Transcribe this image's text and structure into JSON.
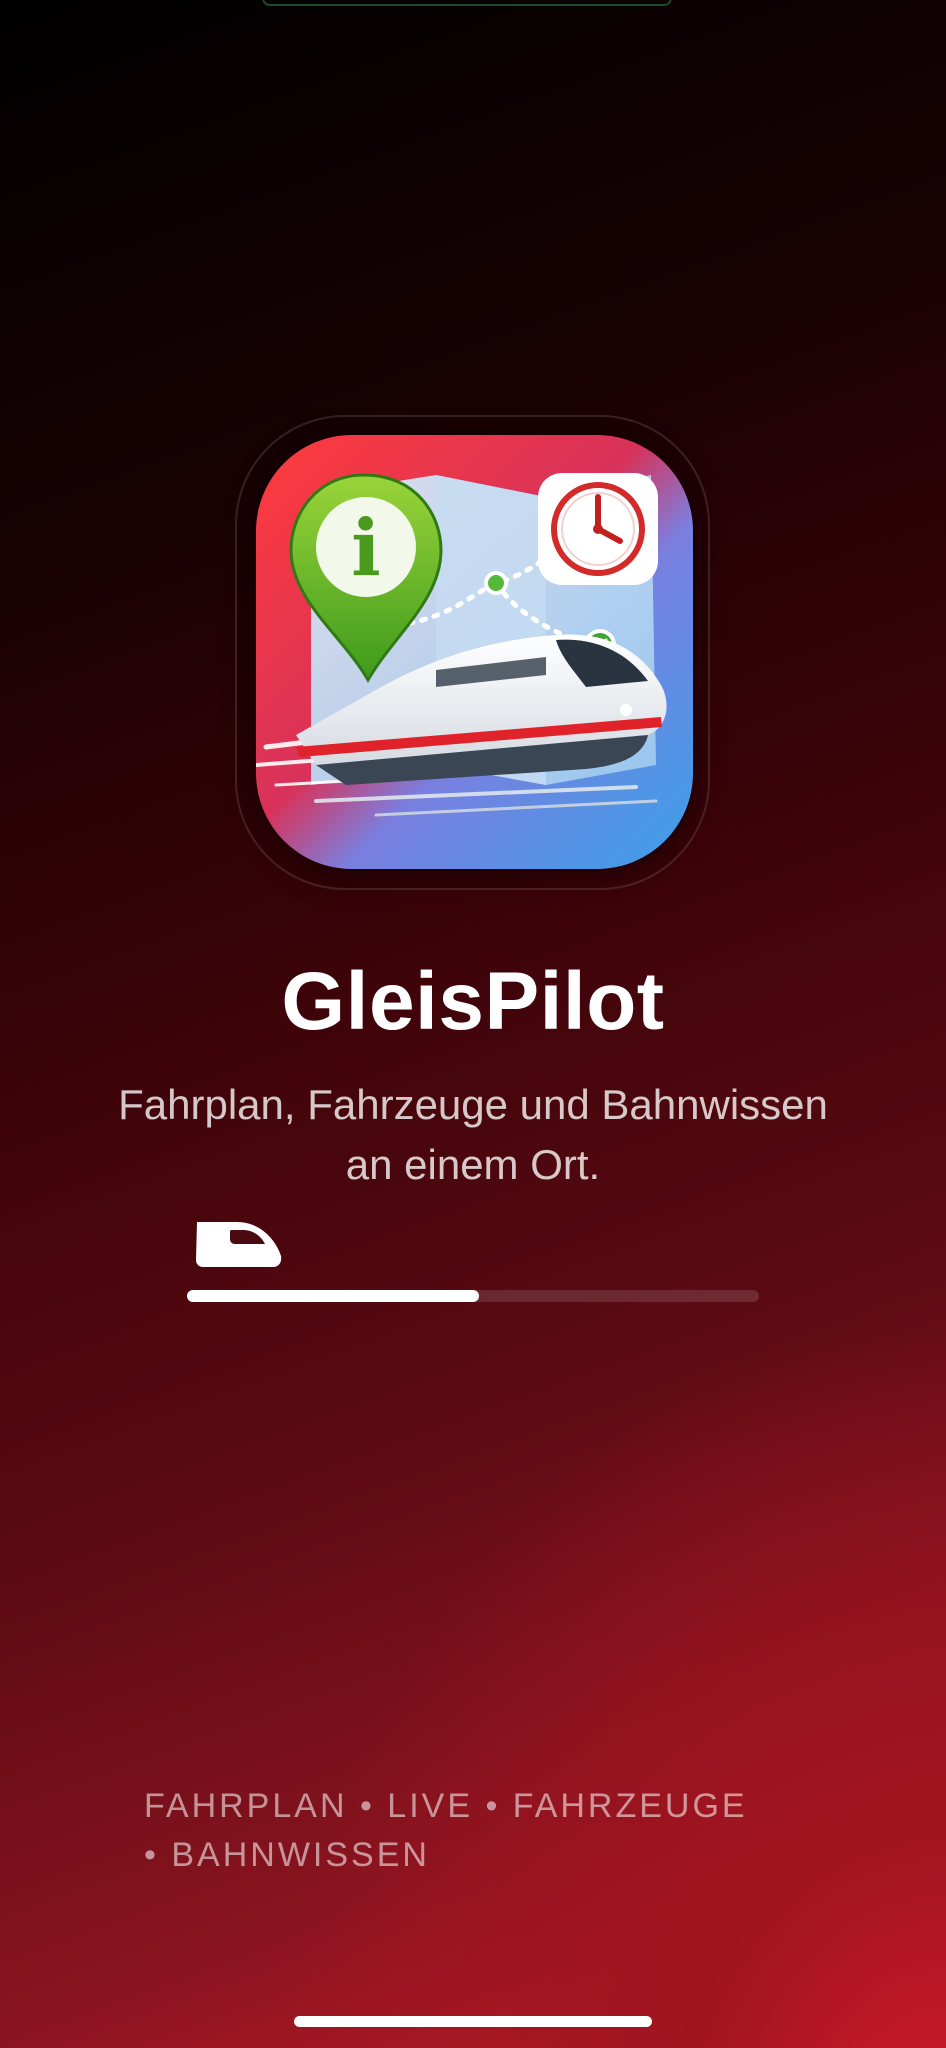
{
  "app": {
    "title": "GleisPilot",
    "subtitle_line1": "Fahrplan, Fahrzeuge und Bahnwissen",
    "subtitle_line2": "an einem Ort.",
    "icon_name": "gleispilot-app-icon",
    "icon_info_glyph": "i"
  },
  "loading": {
    "progress": 0.51,
    "indicator_icon": "train-front-icon"
  },
  "features": {
    "line1": "FAHRPLAN • LIVE • FAHRZEUGE",
    "line2": "• BAHNWISSEN"
  },
  "colors": {
    "accent_red": "#c81a2a",
    "background_dark": "#000000",
    "text_primary": "#ffffff"
  }
}
